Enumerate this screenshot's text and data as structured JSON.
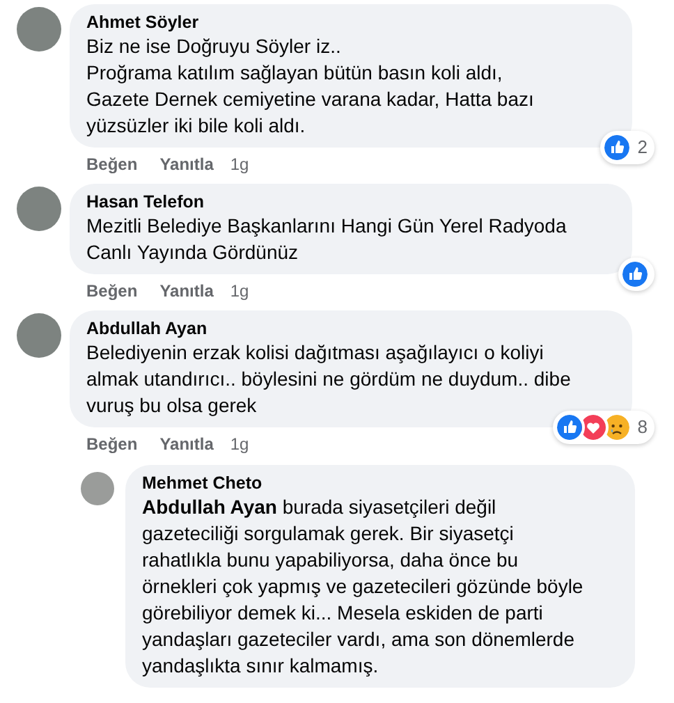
{
  "comments": [
    {
      "author": "Ahmet Söyler",
      "lines": [
        "Biz ne ise Doğruyu Söyler iz..",
        "Proğrama katılım sağlayan bütün basın koli aldı,",
        "Gazete Dernek cemiyetine varana kadar, Hatta bazı",
        "yüzsüzler iki bile koli aldı."
      ],
      "reactions": [
        {
          "kind": "like"
        }
      ],
      "reaction_count": "2",
      "actions": [
        "Beğen",
        "Yanıtla"
      ],
      "time": "1g",
      "is_reply": false
    },
    {
      "author": "Hasan Telefon",
      "lines": [
        "Mezitli Belediye Başkanlarını Hangi Gün Yerel Radyoda",
        "Canlı Yayında Gördünüz"
      ],
      "reactions": [
        {
          "kind": "like"
        }
      ],
      "actions": [
        "Beğen",
        "Yanıtla"
      ],
      "time": "1g",
      "is_reply": false
    },
    {
      "author": "Abdullah Ayan",
      "lines": [
        "Belediyenin erzak kolisi dağıtması aşağılayıcı o koliyi",
        "almak utandırıcı.. böylesini ne gördüm ne duydum.. dibe",
        "vuruş bu olsa gerek"
      ],
      "reactions": [
        {
          "kind": "like"
        },
        {
          "kind": "love"
        },
        {
          "kind": "sad"
        }
      ],
      "reaction_count": "8",
      "actions": [
        "Beğen",
        "Yanıtla"
      ],
      "time": "1g",
      "is_reply": false
    },
    {
      "author": "Mehmet Cheto",
      "lines": [
        "**Abdullah Ayan** burada siyasetçileri değil",
        "gazeteciliği sorgulamak gerek. Bir siyasetçi",
        "rahatlıkla bunu yapabiliyorsa, daha önce bu",
        "örnekleri çok yapmış ve gazetecileri gözünde böyle",
        "görebiliyor demek ki... Mesela eskiden de parti",
        "yandaşları gazeteciler vardı, ama son dönemlerde",
        "yandaşlıkta sınır kalmamış."
      ],
      "is_reply": true
    }
  ]
}
